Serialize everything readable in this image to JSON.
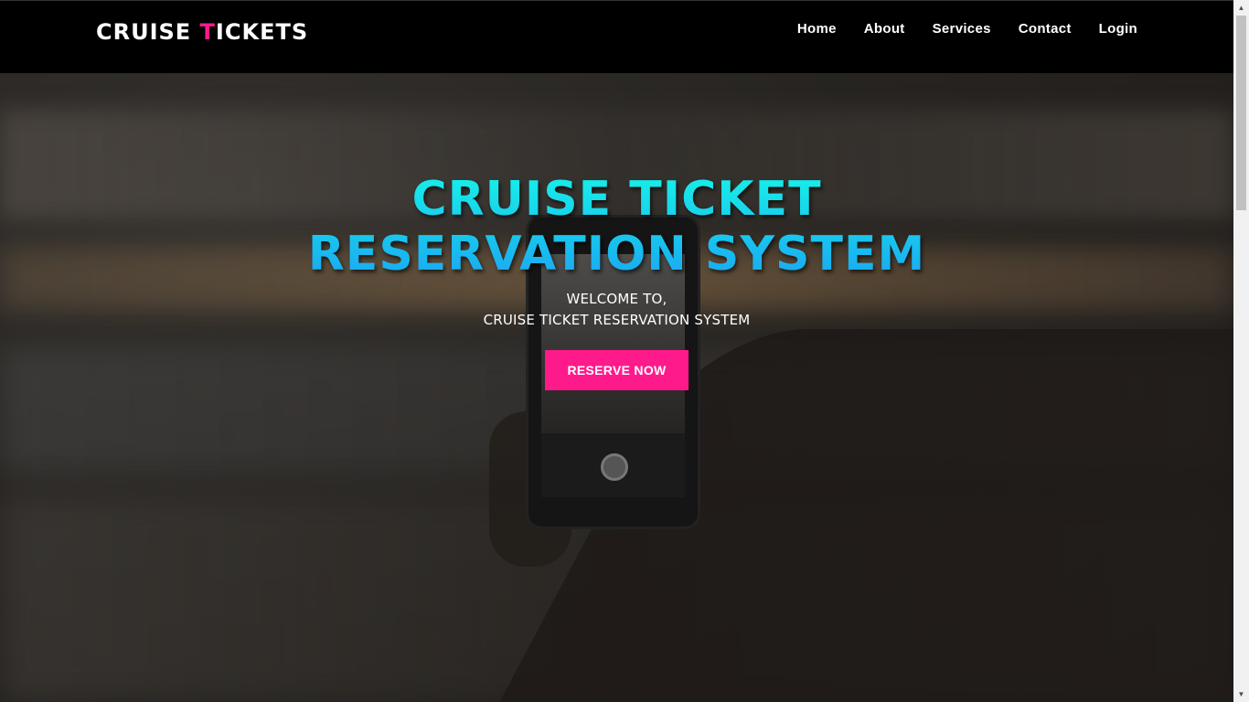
{
  "navbar": {
    "brand_pre": "CRUISE ",
    "brand_accent": "T",
    "brand_post": "ICKETS",
    "items": [
      {
        "label": "Home"
      },
      {
        "label": "About"
      },
      {
        "label": "Services"
      },
      {
        "label": "Contact"
      },
      {
        "label": "Login"
      }
    ]
  },
  "hero": {
    "title_line1": "CRUISE TICKET",
    "title_line2": "RESERVATION SYSTEM",
    "subtitle_line1": "WELCOME TO,",
    "subtitle_line2": "CRUISE TICKET RESERVATION SYSTEM",
    "cta_label": "RESERVE NOW"
  },
  "colors": {
    "accent": "#ff1a8c",
    "title_top": "#17f1e8",
    "title_bottom": "#1aa6f2",
    "navbar_bg": "#000000"
  },
  "icons": {
    "scroll_up": "triangle-up-icon",
    "scroll_down": "triangle-down-icon"
  }
}
